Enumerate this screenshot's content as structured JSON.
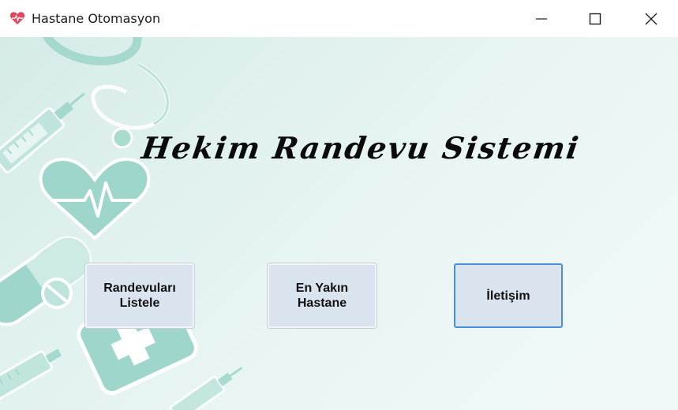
{
  "window": {
    "title": "Hastane Otomasyon",
    "icons": {
      "app": "heart-icon",
      "minimize": "minimize-icon",
      "maximize": "maximize-icon",
      "close": "close-icon"
    }
  },
  "main": {
    "heading": "Hekim Randevu Sistemi",
    "buttons": [
      {
        "label": "Randevuları\nListele"
      },
      {
        "label": "En Yakın\nHastane"
      },
      {
        "label": "İletişim"
      }
    ]
  },
  "colors": {
    "background_teal": "#d5ebe7",
    "decor_teal": "#9fd6cb",
    "button_face": "#dae4ef",
    "focus_border": "#4a90d9"
  }
}
